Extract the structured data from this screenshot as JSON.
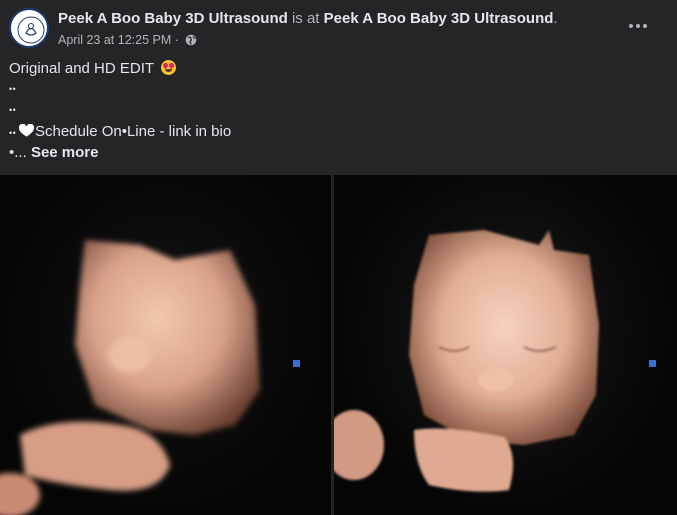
{
  "post": {
    "page_name": "Peek A Boo Baby 3D Ultrasound",
    "is_at": "is at",
    "location": "Peek A Boo Baby 3D Ultrasound",
    "period": ".",
    "timestamp": "April 23 at 12:25 PM",
    "separator": "·",
    "audience_icon": "globe-icon",
    "more_icon": "ellipsis-icon",
    "more_label": "•••"
  },
  "caption": {
    "line1": "Original and HD EDIT",
    "line1_emoji": "star-struck-emoji",
    "line2": "• •",
    "line3": "• •",
    "line4_prefix": "• •",
    "line4_text": "Schedule On•Line - link in bio",
    "line5_prefix": "•...",
    "see_more": "See more"
  },
  "media": {
    "photos": [
      {
        "name": "original-ultrasound-photo"
      },
      {
        "name": "hd-edit-ultrasound-photo"
      }
    ]
  },
  "colors": {
    "background": "#242526",
    "text_primary": "#e4e6eb",
    "text_secondary": "#b0b3b8",
    "skin_tone": "#e8b8a0"
  }
}
